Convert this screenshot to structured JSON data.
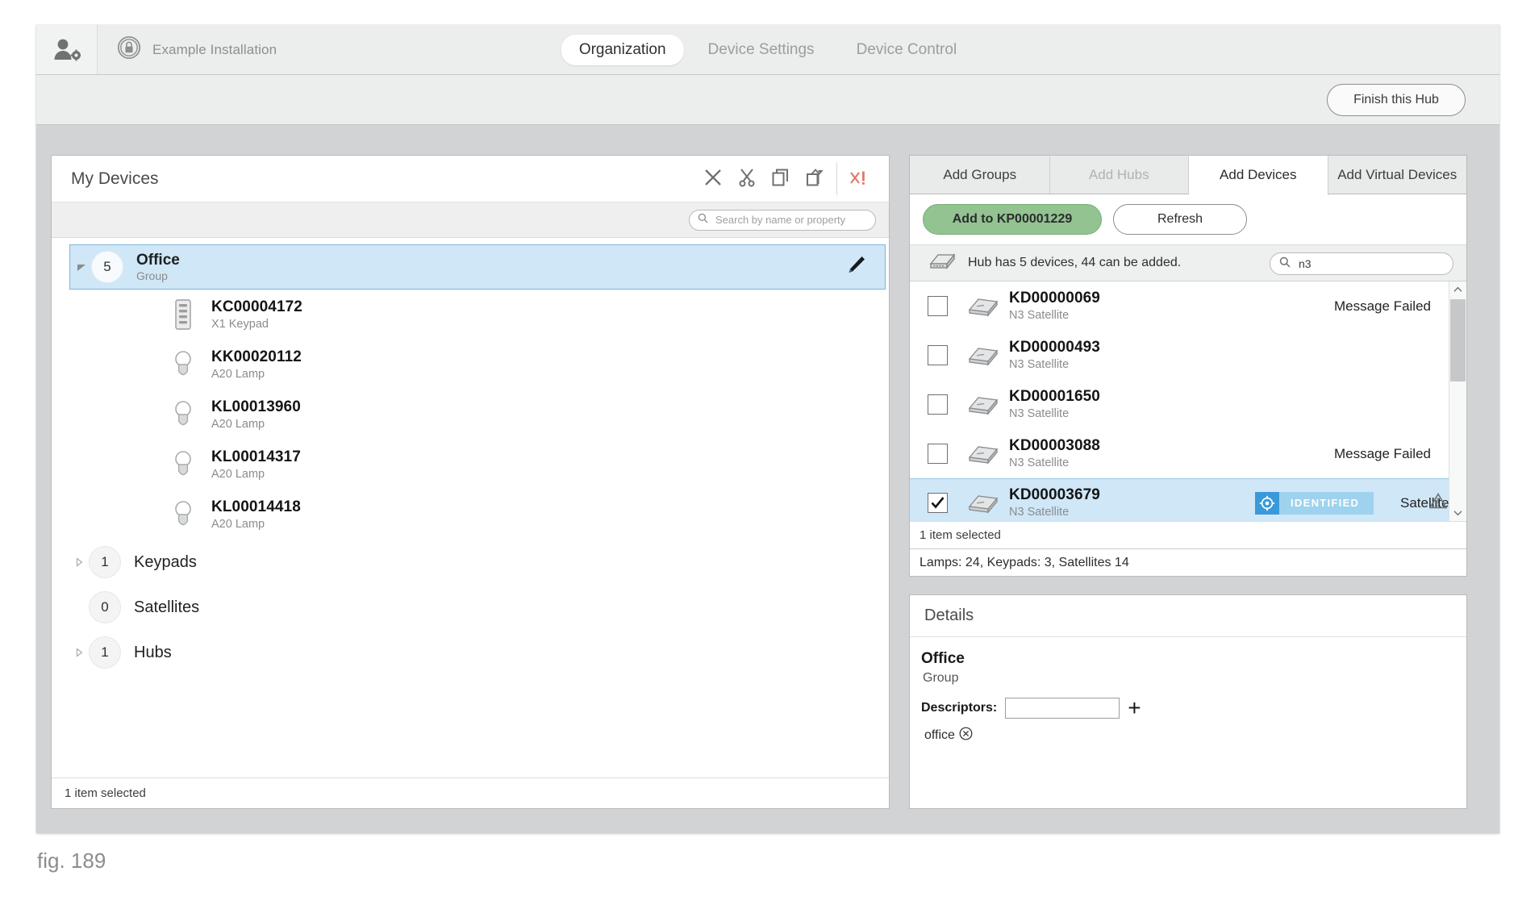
{
  "header": {
    "user_icon": "user-settings-icon",
    "lock_icon": "lock-badge-icon",
    "installation_name": "Example Installation",
    "tabs": [
      {
        "label": "Organization",
        "active": true
      },
      {
        "label": "Device Settings",
        "active": false
      },
      {
        "label": "Device Control",
        "active": false
      }
    ]
  },
  "actionbar": {
    "finish_label": "Finish this Hub"
  },
  "left_panel": {
    "title": "My Devices",
    "tools": [
      {
        "name": "delete-icon",
        "glyph": "X"
      },
      {
        "name": "cut-icon",
        "glyph": "scissors"
      },
      {
        "name": "copy-icon",
        "glyph": "copy"
      },
      {
        "name": "paste-icon",
        "glyph": "paste"
      },
      {
        "name": "remove-all-icon",
        "glyph": "x!"
      }
    ],
    "search": {
      "placeholder": "Search by name or property",
      "value": ""
    },
    "tree": [
      {
        "count": "5",
        "name": "Office",
        "sub": "Group",
        "selected": true,
        "expanded": true,
        "has_edit": true,
        "children": [
          {
            "name": "KC00004172",
            "sub": "X1 Keypad",
            "icon": "keypad-icon"
          },
          {
            "name": "KK00020112",
            "sub": "A20 Lamp",
            "icon": "lamp-icon"
          },
          {
            "name": "KL00013960",
            "sub": "A20 Lamp",
            "icon": "lamp-icon"
          },
          {
            "name": "KL00014317",
            "sub": "A20 Lamp",
            "icon": "lamp-icon"
          },
          {
            "name": "KL00014418",
            "sub": "A20 Lamp",
            "icon": "lamp-icon"
          }
        ]
      },
      {
        "count": "1",
        "name": "Keypads",
        "sub": "",
        "selected": false,
        "expanded": false,
        "has_edit": false,
        "children": []
      },
      {
        "count": "0",
        "name": "Satellites",
        "sub": "",
        "selected": false,
        "expanded": false,
        "has_edit": false,
        "children": []
      },
      {
        "count": "1",
        "name": "Hubs",
        "sub": "",
        "selected": false,
        "expanded": false,
        "has_edit": false,
        "children": []
      }
    ],
    "footer_status": "1 item selected"
  },
  "right_panel": {
    "tabs": [
      {
        "label": "Add Groups",
        "state": "normal"
      },
      {
        "label": "Add Hubs",
        "state": "disabled"
      },
      {
        "label": "Add Devices",
        "state": "active"
      },
      {
        "label": "Add Virtual Devices",
        "state": "normal"
      }
    ],
    "add_button_label": "Add to KP00001229",
    "refresh_button_label": "Refresh",
    "hub_info": "Hub has 5 devices, 44 can be added.",
    "hub_search": {
      "value": "n3",
      "placeholder": ""
    },
    "devices": [
      {
        "name": "KD00000069",
        "sub": "N3 Satellite",
        "checked": false,
        "selected": false,
        "status": "Message Failed",
        "badge": null,
        "warn": false
      },
      {
        "name": "KD00000493",
        "sub": "N3 Satellite",
        "checked": false,
        "selected": false,
        "status": "",
        "badge": null,
        "warn": false
      },
      {
        "name": "KD00001650",
        "sub": "N3 Satellite",
        "checked": false,
        "selected": false,
        "status": "",
        "badge": null,
        "warn": false
      },
      {
        "name": "KD00003088",
        "sub": "N3 Satellite",
        "checked": false,
        "selected": false,
        "status": "Message Failed",
        "badge": null,
        "warn": false
      },
      {
        "name": "KD00003679",
        "sub": "N3 Satellite",
        "checked": true,
        "selected": true,
        "status": "Satellite still initializing",
        "badge": "IDENTIFIED",
        "warn": true
      }
    ],
    "selection_status": "1 item selected",
    "totals_status": "Lamps: 24, Keypads: 3, Satellites 14"
  },
  "details": {
    "header": "Details",
    "title": "Office",
    "subtitle": "Group",
    "descriptors_label": "Descriptors:",
    "descriptors_value": "",
    "add_glyph": "+",
    "tags": [
      {
        "label": "office",
        "remove_icon": "remove-circle-icon"
      }
    ]
  },
  "caption": "fig. 189",
  "colors": {
    "accent_green": "#92c391",
    "selection_blue": "#cfe7f7",
    "badge_blue": "#3a9ad9",
    "badge_light": "#9ed2ef",
    "window_bg": "#eceded",
    "body_bg": "#d2d3d4"
  }
}
